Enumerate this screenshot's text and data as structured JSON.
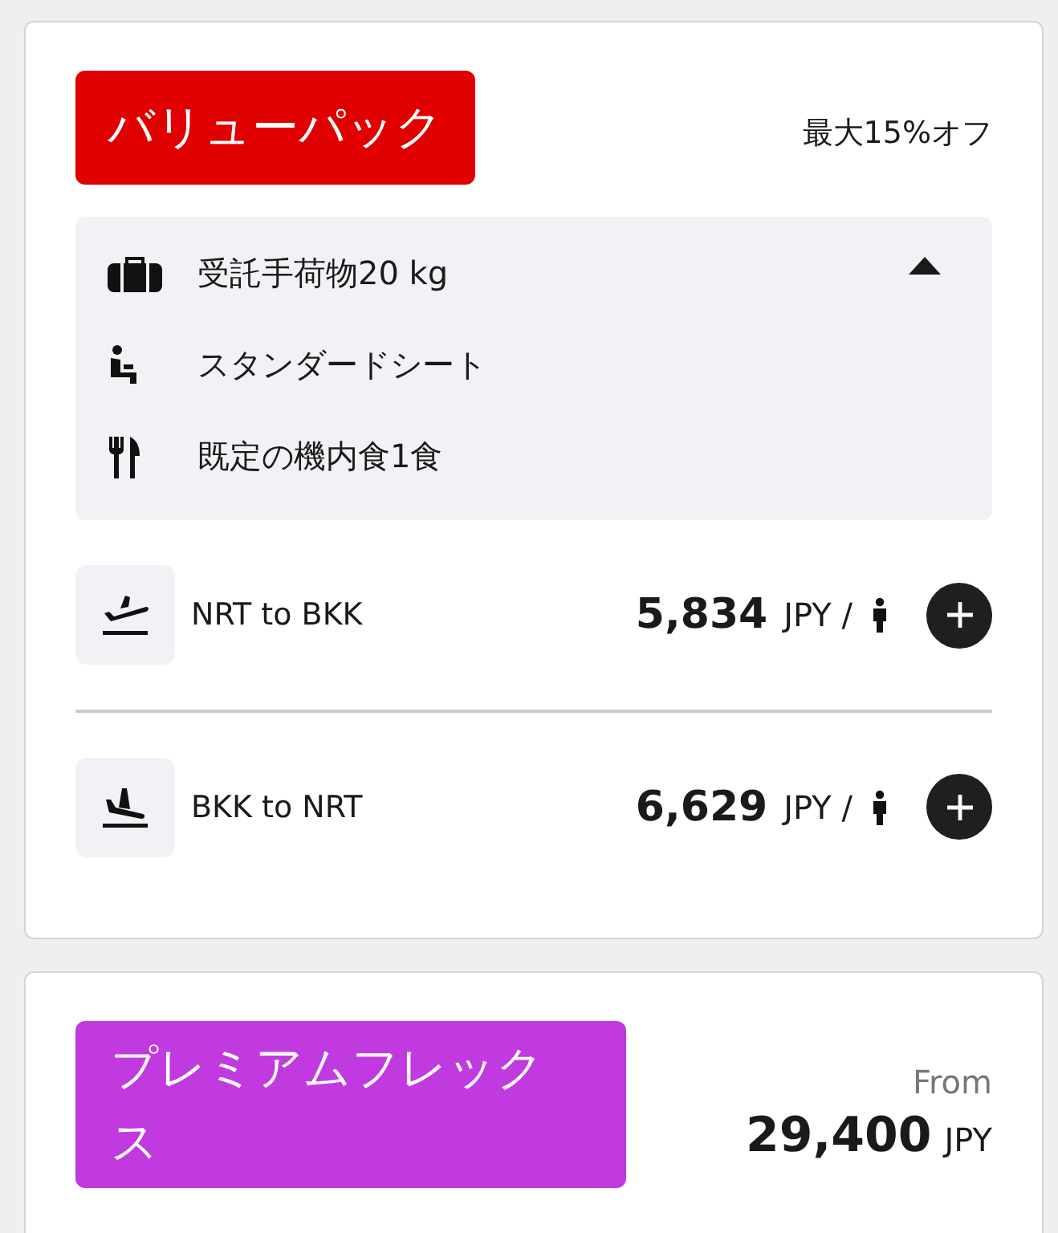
{
  "bundles": [
    {
      "name": "バリューパック",
      "color": "#e00000",
      "discount": "最大15%オフ",
      "expanded": true,
      "features": [
        {
          "kind": "baggage",
          "text": "受託手荷物20 kg"
        },
        {
          "kind": "seat",
          "text": "スタンダードシート"
        },
        {
          "kind": "meal",
          "text": "既定の機内食1食"
        }
      ],
      "flights": [
        {
          "kind": "departure",
          "route": "NRT to BKK",
          "price": "5,834",
          "currency": "JPY /"
        },
        {
          "kind": "return",
          "route": "BKK to NRT",
          "price": "6,629",
          "currency": "JPY /"
        }
      ]
    },
    {
      "name": "プレミアムフレックス",
      "color": "#c03ae0",
      "from_label": "From",
      "price": "29,400",
      "currency": "JPY"
    }
  ]
}
